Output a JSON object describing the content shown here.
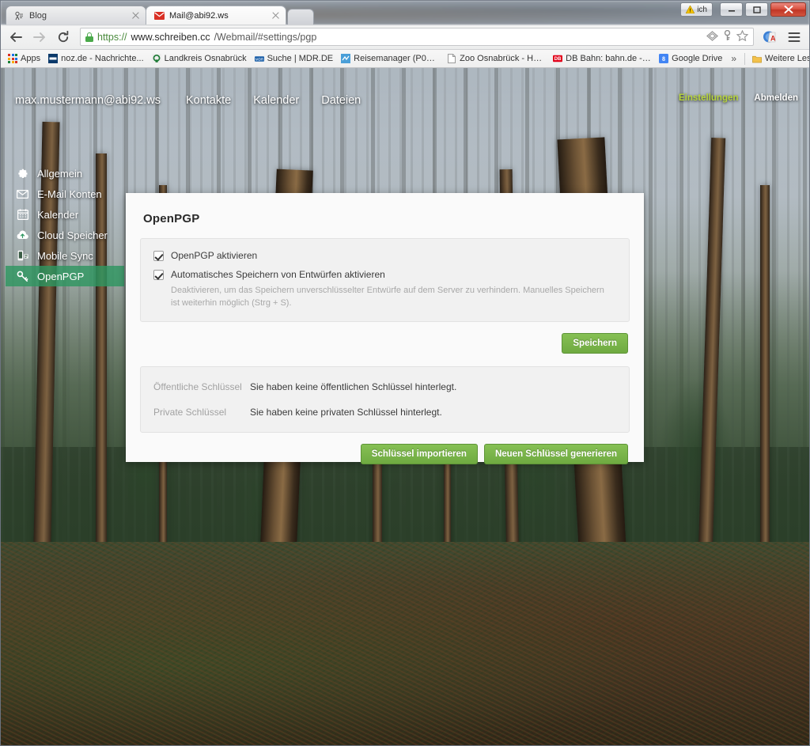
{
  "browser": {
    "window_buttons": {
      "user_label": "ich",
      "minimize": "—",
      "maximize": "❐",
      "close": "✕"
    },
    "tabs": [
      {
        "title": "Blog",
        "favicon": "blog-favicon",
        "active": false
      },
      {
        "title": "Mail@abi92.ws",
        "favicon": "mail-favicon",
        "active": true
      }
    ],
    "nav": {
      "back": "←",
      "forward": "→",
      "reload": "⟳"
    },
    "omnibox": {
      "scheme": "https://",
      "host": "www.schreiben.cc",
      "path": "/Webmail/#settings/pgp",
      "full_url": "https://www.schreiben.cc/Webmail/#settings/pgp",
      "secure": true
    },
    "bookmarks": {
      "apps_label": "Apps",
      "items": [
        {
          "label": "noz.de - Nachrichte...",
          "icon": "noz-favicon"
        },
        {
          "label": "Landkreis Osnabrück",
          "icon": "landkreis-favicon"
        },
        {
          "label": "Suche | MDR.DE",
          "icon": "mdr-favicon"
        },
        {
          "label": "Reisemanager (P01 ...",
          "icon": "reisemanager-favicon"
        },
        {
          "label": "Zoo Osnabrück - Ho...",
          "icon": "page-favicon"
        },
        {
          "label": "DB Bahn: bahn.de - ...",
          "icon": "db-favicon"
        },
        {
          "label": "Google Drive",
          "icon": "gdrive-favicon"
        }
      ],
      "overflow": "»",
      "other_label": "Weitere Lesezeichen"
    }
  },
  "webmail": {
    "account": "max.mustermann@abi92.ws",
    "nav": [
      {
        "label": "Kontakte"
      },
      {
        "label": "Kalender"
      },
      {
        "label": "Dateien"
      }
    ],
    "settings_label": "Einstellungen",
    "logout_label": "Abmelden",
    "accent_green": "#b7d53c",
    "sidebar": [
      {
        "label": "Allgemein",
        "icon": "gear-icon",
        "active": false
      },
      {
        "label": "E-Mail Konten",
        "icon": "envelope-icon",
        "active": false
      },
      {
        "label": "Kalender",
        "icon": "calendar-icon",
        "active": false
      },
      {
        "label": "Cloud Speicher",
        "icon": "cloud-upload-icon",
        "active": false
      },
      {
        "label": "Mobile Sync",
        "icon": "mobile-icon",
        "active": false
      },
      {
        "label": "OpenPGP",
        "icon": "key-icon",
        "active": true
      }
    ],
    "page": {
      "title": "OpenPGP",
      "checkbox_enable": {
        "label": "OpenPGP aktivieren",
        "checked": true
      },
      "checkbox_autosave": {
        "label": "Automatisches Speichern von Entwürfen aktivieren",
        "checked": true
      },
      "autosave_hint": "Deaktivieren, um das Speichern unverschlüsselter Entwürfe auf dem Server zu verhindern. Manuelles Speichern ist weiterhin möglich (Strg + S).",
      "save_button": "Speichern",
      "keys": [
        {
          "label": "Öffentliche Schlüssel",
          "value": "Sie haben keine öffentlichen Schlüssel hinterlegt."
        },
        {
          "label": "Private Schlüssel",
          "value": "Sie haben keine privaten Schlüssel hinterlegt."
        }
      ],
      "import_button": "Schlüssel importieren",
      "generate_button": "Neuen Schlüssel generieren",
      "button_green": "#6faa41"
    }
  }
}
